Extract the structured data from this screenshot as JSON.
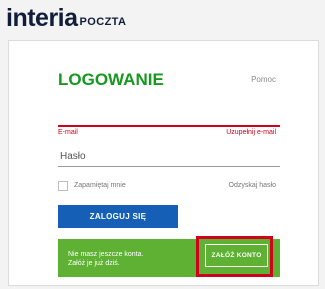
{
  "header": {
    "logo_main": "interia",
    "logo_sub": "POCZTA"
  },
  "login": {
    "title": "LOGOWANIE",
    "help_link": "Pomoc",
    "email_label": "E-mail",
    "email_value": "",
    "email_error": "Uzupełnij e-mail",
    "password_placeholder": "Hasło",
    "remember_label": "Zapamiętaj mnie",
    "remember_checked": false,
    "forgot_link": "Odzyskaj hasło",
    "submit_label": "ZALOGUJ SIĘ"
  },
  "register": {
    "line1": "Nie masz jeszcze konta.",
    "line2": "Załóż je już dziś.",
    "button_label": "ZAŁÓŻ KONTO"
  },
  "colors": {
    "brand_navy": "#121d3b",
    "title_green": "#17981f",
    "error_red": "#d0021b",
    "button_blue": "#1560b6",
    "promo_green": "#5eb133"
  }
}
